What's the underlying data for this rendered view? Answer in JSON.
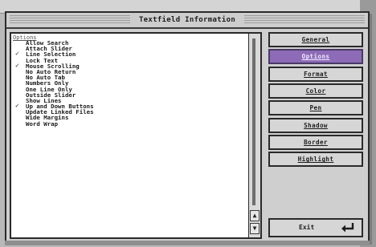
{
  "window": {
    "title": "Textfield Information"
  },
  "list": {
    "header": "Options",
    "items": [
      {
        "label": "Allow Search",
        "checked": false
      },
      {
        "label": "Attach Slider",
        "checked": false
      },
      {
        "label": "Line Selection",
        "checked": true
      },
      {
        "label": "Lock Text",
        "checked": false
      },
      {
        "label": "Mouse Scrolling",
        "checked": true
      },
      {
        "label": "No Auto Return",
        "checked": false
      },
      {
        "label": "No Auto Tab",
        "checked": false
      },
      {
        "label": "Numbers Only",
        "checked": false
      },
      {
        "label": "One Line Only",
        "checked": false
      },
      {
        "label": "Outside Slider",
        "checked": false
      },
      {
        "label": "Show Lines",
        "checked": false
      },
      {
        "label": "Up and Down Buttons",
        "checked": true
      },
      {
        "label": "Update Linked Files",
        "checked": false
      },
      {
        "label": "Wide Margins",
        "checked": false
      },
      {
        "label": "Word Wrap",
        "checked": false
      }
    ],
    "check_glyph": "✓",
    "scroll_up_glyph": "▲",
    "scroll_down_glyph": "▼"
  },
  "buttons": [
    {
      "label": "General",
      "active": false
    },
    {
      "label": "Options",
      "active": true
    },
    {
      "label": "Format",
      "active": false
    },
    {
      "label": "Color",
      "active": false
    },
    {
      "label": "Pen",
      "active": false
    },
    {
      "label": "Shadow",
      "active": false
    },
    {
      "label": "Border",
      "active": false
    },
    {
      "label": "Highlight",
      "active": false
    }
  ],
  "exit": {
    "label": "Exit",
    "icon": "enter-return-icon"
  },
  "colors": {
    "active_button": "#8d6bb7",
    "panel_background": "#ffffff",
    "window_background": "#cfcfcf"
  }
}
